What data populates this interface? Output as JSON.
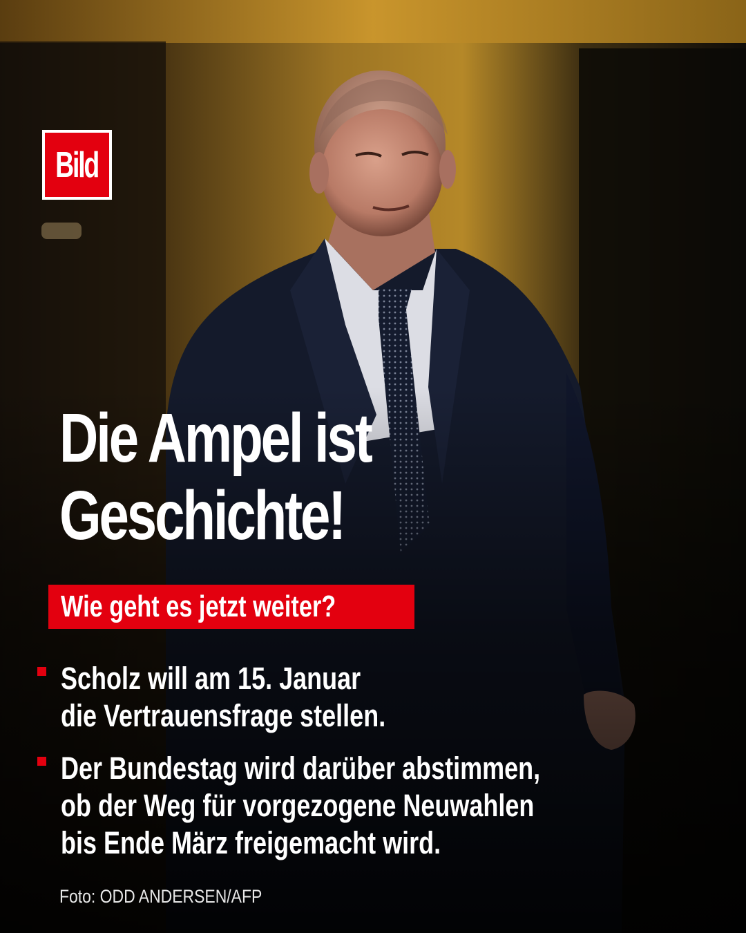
{
  "brand": {
    "logo_text": "Bild",
    "accent": "#e3000f"
  },
  "headline": {
    "lines": [
      "Die Ampel ist",
      "Geschichte!"
    ]
  },
  "subheadline": "Wie geht es jetzt weiter?",
  "bullets": [
    {
      "lines": [
        "Scholz will am 15. Januar",
        "die Vertrauensfrage stellen."
      ]
    },
    {
      "lines": [
        "Der Bundestag wird darüber abstimmen,",
        "ob der Weg für vorgezogene Neuwahlen",
        "bis Ende März freigemacht wird."
      ]
    }
  ],
  "credit": "Foto: ODD ANDERSEN/AFP",
  "photo": {
    "subject": "man in dark suit, white shirt and dark dotted tie walking",
    "palette": {
      "wall": "#b88a2a",
      "suit": "#151a2c",
      "shirt": "#dcdde4",
      "skin": "#c48c78"
    }
  }
}
